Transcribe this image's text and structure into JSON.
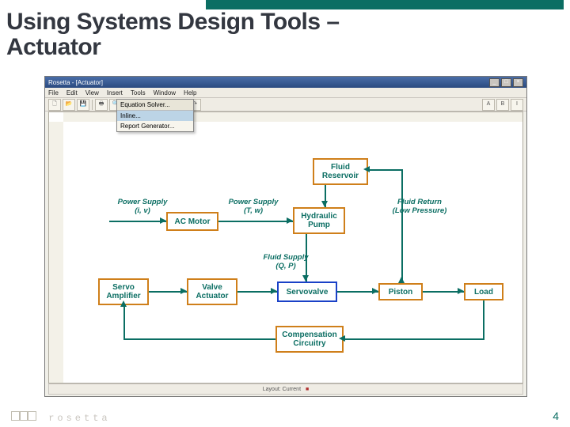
{
  "slide": {
    "title_line1": "Using Systems Design Tools –",
    "title_line2": "Actuator",
    "page_number": "4",
    "logo_text": "rosetta"
  },
  "app": {
    "titlebar": "Rosetta - [Actuator]",
    "menubar": [
      "File",
      "Edit",
      "View",
      "Insert",
      "Tools",
      "Window",
      "Help"
    ],
    "dropdown": {
      "header": "Equation Solver...",
      "items": [
        "Inline...",
        "Report Generator..."
      ]
    },
    "status": {
      "left": "",
      "mid": "Layout: Current",
      "badge": "■"
    }
  },
  "diagram": {
    "nodes": {
      "fluid_reservoir": "Fluid\nReservoir",
      "ac_motor": "AC Motor",
      "hydraulic_pump": "Hydraulic\nPump",
      "servo_amplifier": "Servo\nAmplifier",
      "valve_actuator": "Valve\nActuator",
      "servovalve": "Servovalve",
      "piston": "Piston",
      "load": "Load",
      "compensation": "Compensation\nCircuitry"
    },
    "labels": {
      "power_supply_iv": "Power Supply\n(i, v)",
      "power_supply_tw": "Power Supply\n(T, w)",
      "fluid_return": "Fluid Return\n(Low Pressure)",
      "fluid_supply_qp": "Fluid Supply\n(Q, P)"
    }
  }
}
